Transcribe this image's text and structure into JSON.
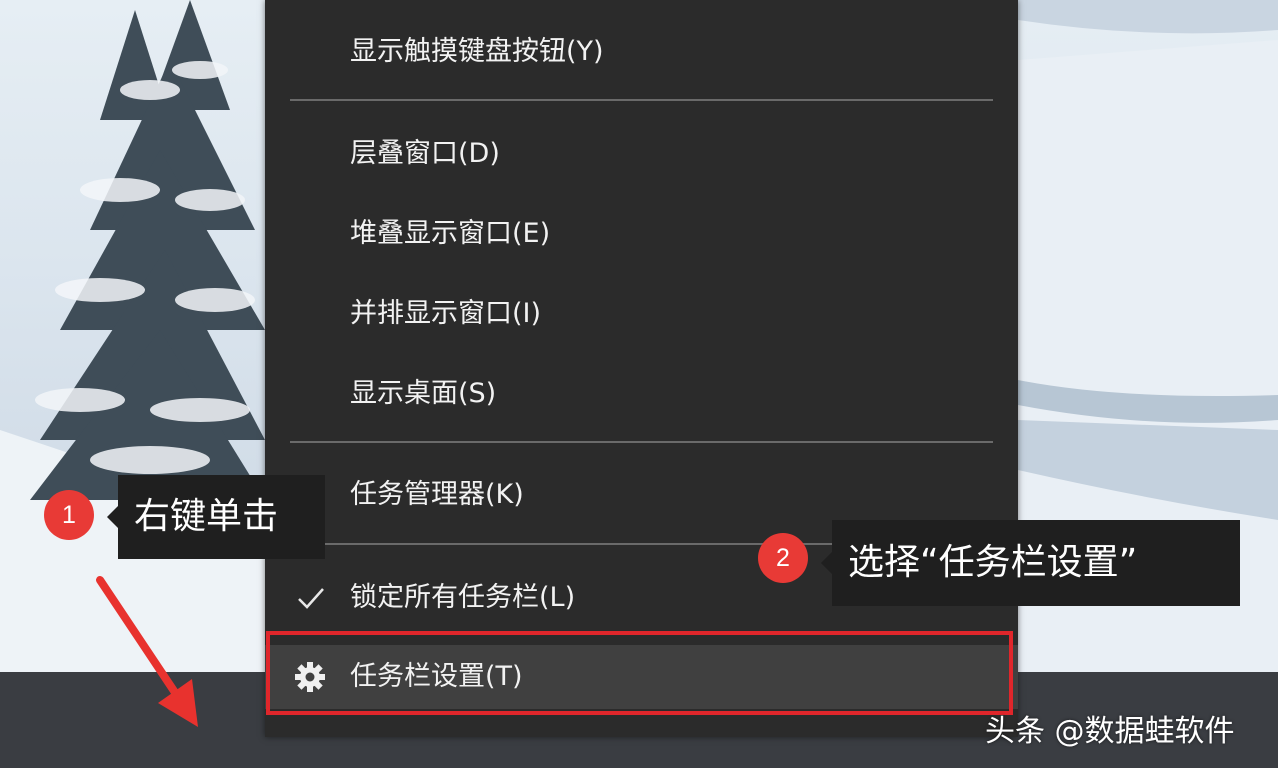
{
  "context_menu": {
    "items": [
      {
        "label": "显示触摸键盘按钮(Y)"
      },
      {
        "label": "层叠窗口(D)"
      },
      {
        "label": "堆叠显示窗口(E)"
      },
      {
        "label": "并排显示窗口(I)"
      },
      {
        "label": "显示桌面(S)"
      },
      {
        "label": "任务管理器(K)"
      },
      {
        "label": "锁定所有任务栏(L)",
        "checked": true,
        "icon": "check-icon"
      },
      {
        "label": "任务栏设置(T)",
        "icon": "gear-icon",
        "highlighted": true
      }
    ]
  },
  "annotations": {
    "step1": {
      "number": "1",
      "text": "右键单击"
    },
    "step2": {
      "number": "2",
      "text": "选择“任务栏设置”"
    }
  },
  "watermark": "头条 @数据蛙软件",
  "colors": {
    "menu_bg": "#2b2b2b",
    "highlight_border": "#e0262b",
    "badge": "#e83a36",
    "taskbar": "#3a3d42"
  }
}
